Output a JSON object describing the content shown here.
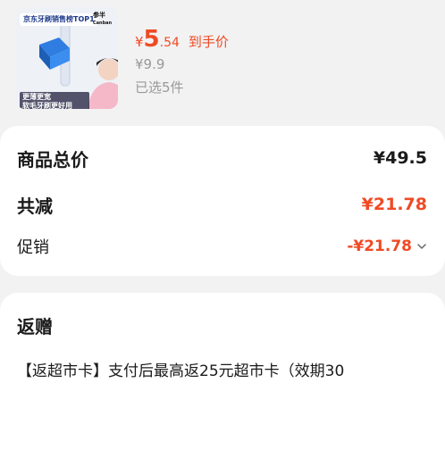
{
  "product": {
    "thumb_tag": "京东牙刷销售榜TOP1",
    "thumb_brand": "参半",
    "thumb_brand_sub": "Canban",
    "thumb_slogan_1": "更薄更宽",
    "thumb_slogan_2": "软毛牙刷更好用",
    "price_symbol": "¥",
    "price_int": "5",
    "price_dec": ".54",
    "price_suffix": "到手价",
    "original_price": "¥9.9",
    "selected_count": "已选5件"
  },
  "summary": {
    "total_label": "商品总价",
    "total_value": "¥49.5",
    "reduce_label": "共减",
    "reduce_value": "¥21.78",
    "promo_label": "促销",
    "promo_value": "-¥21.78"
  },
  "gift": {
    "title": "返赠",
    "description": "【返超市卡】支付后最高返25元超市卡（效期30"
  },
  "colors": {
    "accent_red": "#f04a24",
    "muted_gray": "#999999",
    "background": "#f2f2f2"
  },
  "icons": {
    "promo_expand": "chevron-down-icon"
  }
}
